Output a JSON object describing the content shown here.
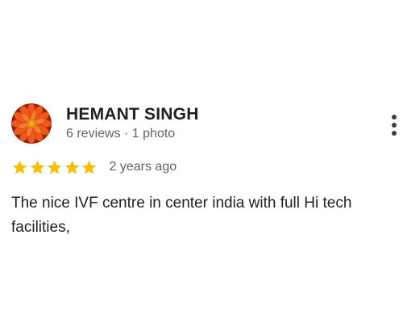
{
  "review": {
    "author": {
      "name": "HEMANT SINGH",
      "meta": "6 reviews · 1 photo",
      "avatar_icon": "flower-avatar-icon"
    },
    "rating": {
      "value": 5,
      "max": 5,
      "star_color": "#fbbc04"
    },
    "time": "2 years ago",
    "text": "The nice IVF centre in center india with full Hi tech facilities,",
    "more_icon": "more-vert-icon"
  }
}
